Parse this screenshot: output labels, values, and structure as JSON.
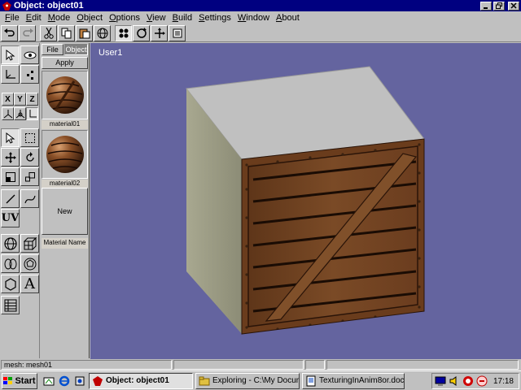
{
  "window": {
    "title": "Object: object01"
  },
  "menu": [
    "File",
    "Edit",
    "Mode",
    "Object",
    "Options",
    "View",
    "Build",
    "Settings",
    "Window",
    "About"
  ],
  "material_panel": {
    "tabs": [
      "File",
      "Object"
    ],
    "apply_label": "Apply",
    "materials": [
      {
        "name": "material01"
      },
      {
        "name": "material02"
      }
    ],
    "new_label": "New",
    "material_name_label": "Material Name"
  },
  "tools": {
    "axis_x": "X",
    "axis_y": "Y",
    "axis_z": "Z",
    "uv_label": "UV",
    "text_tool": "A"
  },
  "viewport": {
    "label": "User1"
  },
  "status": {
    "mesh": "mesh: mesh01"
  },
  "taskbar": {
    "start_label": "Start",
    "tasks": [
      {
        "label": "Object: object01",
        "active": true
      },
      {
        "label": "Exploring - C:\\My Docume...",
        "active": false
      },
      {
        "label": "TexturingInAnim8or.doc - ...",
        "active": false
      }
    ],
    "clock": "17:18"
  },
  "colors": {
    "titlebar": "#000080",
    "viewport_bg": "#64649f",
    "chrome": "#c0c0c0"
  }
}
